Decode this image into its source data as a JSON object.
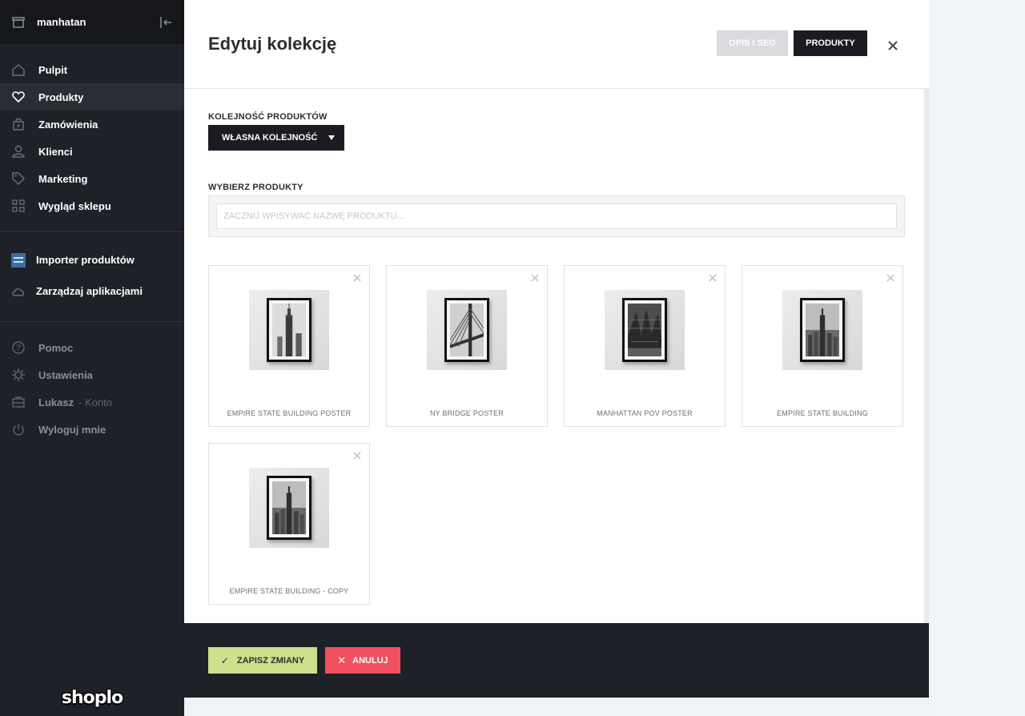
{
  "sidebar": {
    "store_name": "manhatan",
    "nav": [
      {
        "label": "Pulpit",
        "icon": "home-icon"
      },
      {
        "label": "Produkty",
        "icon": "heart-icon"
      },
      {
        "label": "Zamówienia",
        "icon": "bag-icon"
      },
      {
        "label": "Klienci",
        "icon": "user-icon"
      },
      {
        "label": "Marketing",
        "icon": "tag-icon"
      },
      {
        "label": "Wygląd sklepu",
        "icon": "grid-icon"
      }
    ],
    "apps": [
      {
        "label": "Importer produktów",
        "icon": "importer-app-icon"
      },
      {
        "label": "Zarządzaj aplikacjami",
        "icon": "cloud-icon"
      }
    ],
    "secondary": [
      {
        "label": "Pomoc",
        "icon": "help-icon"
      },
      {
        "label": "Ustawienia",
        "icon": "gear-icon"
      },
      {
        "label": "Lukasz",
        "suffix": "- Konto",
        "icon": "briefcase-icon"
      },
      {
        "label": "Wyloguj mnie",
        "icon": "power-icon"
      }
    ],
    "brand": "shoplo"
  },
  "modal": {
    "title": "Edytuj kolekcję",
    "tabs": {
      "seo": "OPIS I SEO",
      "products": "PRODUKTY"
    },
    "order_label": "KOLEJNOŚĆ PRODUKTÓW",
    "order_value": "WŁASNA KOLEJNOŚĆ",
    "select_label": "WYBIERZ PRODUKTY",
    "search_placeholder": "ZACZNIJ WPISYWAĆ NAZWĘ PRODUKTU...",
    "products": [
      {
        "name": "EMPIRE STATE BUILDING POSTER"
      },
      {
        "name": "NY BRIDGE POSTER"
      },
      {
        "name": "MANHATTAN POV POSTER"
      },
      {
        "name": "EMPIRE STATE BUILDING"
      },
      {
        "name": "EMPIRE STATE BUILDING - COPY"
      }
    ],
    "save_label": "ZAPISZ ZMIANY",
    "cancel_label": "ANULUJ"
  },
  "colors": {
    "sidebar_bg": "#1e2127",
    "save_bg": "#cfe08b",
    "cancel_bg": "#f0505f",
    "dark_button": "#1a1c21"
  }
}
